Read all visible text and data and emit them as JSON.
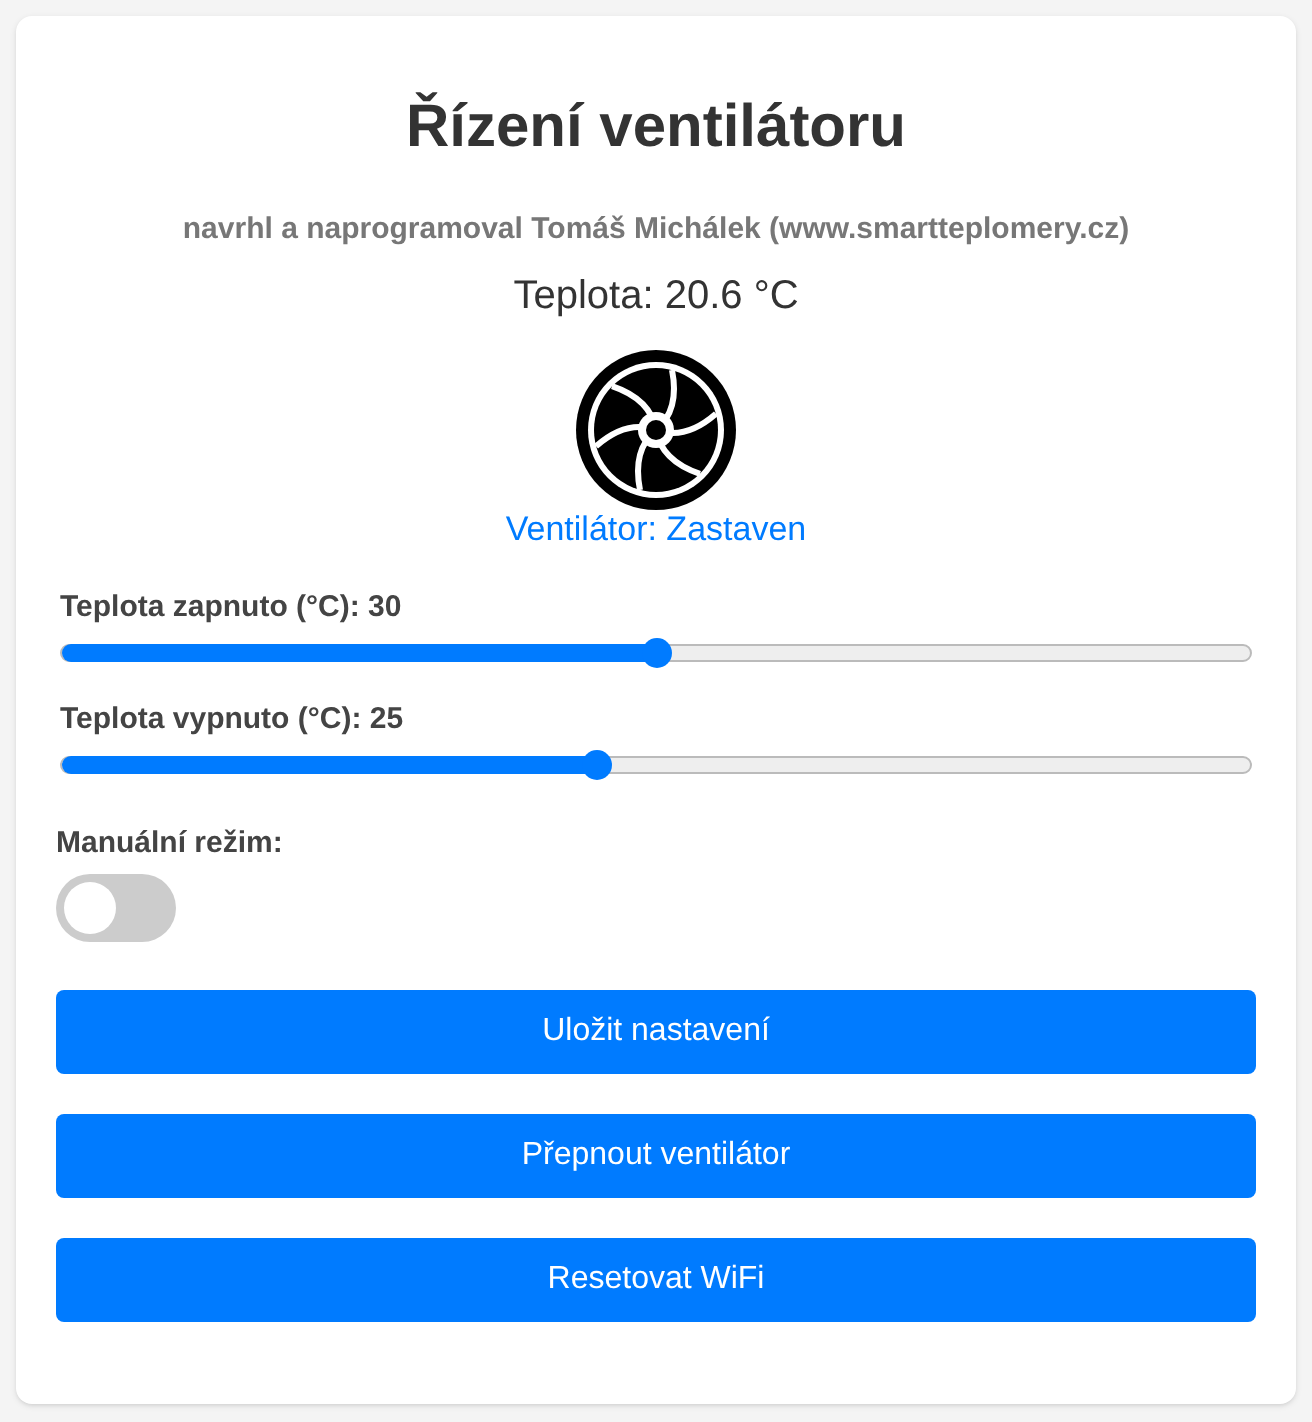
{
  "title": "Řízení ventilátoru",
  "subtitle": "navrhl a naprogramoval Tomáš Michálek (www.smartteplomery.cz)",
  "temperature": "Teplota: 20.6 °C",
  "fan_status": "Ventilátor: Zastaven",
  "sliders": [
    {
      "label": "Teplota zapnuto (°C): 30",
      "level": 0.5
    },
    {
      "label": "Teplota vypnuto (°C): 25",
      "level": 0.45
    }
  ],
  "manual_mode": {
    "label": "Manuální režim:",
    "on": false
  },
  "buttons": [
    "Uložit nastavení",
    "Přepnout ventilátor",
    "Resetovat WiFi"
  ]
}
